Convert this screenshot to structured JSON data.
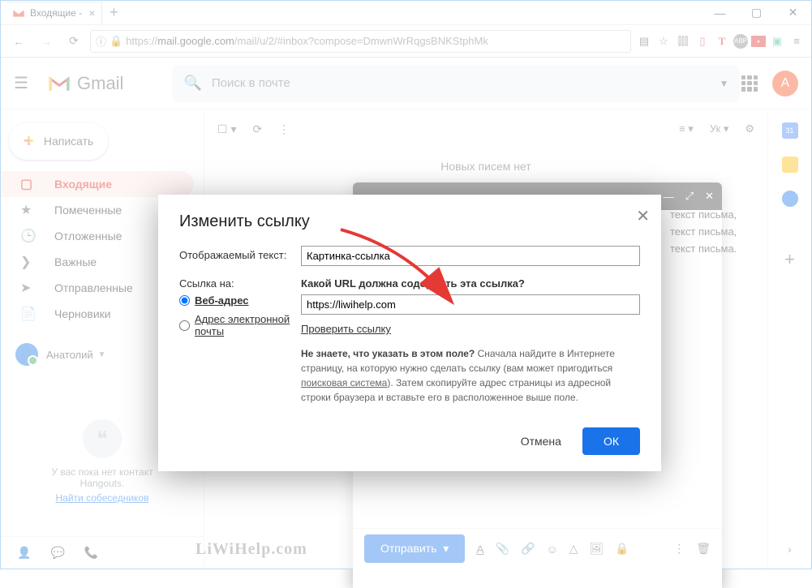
{
  "browser": {
    "tab_title": "Входящие -",
    "url_prefix": "https://",
    "url_host": "mail.google.com",
    "url_path": "/mail/u/2/#inbox?compose=DmwnWrRqgsBNKStphMk",
    "info_icon": "ⓘ"
  },
  "gmail": {
    "brand": "Gmail",
    "search_placeholder": "Поиск в почте",
    "avatar_letter": "А",
    "compose_label": "Написать",
    "nav": {
      "inbox": "Входящие",
      "starred": "Помеченные",
      "snoozed": "Отложенные",
      "important": "Важные",
      "sent": "Отправленные",
      "drafts": "Черновики"
    },
    "user_name": "Анатолий",
    "hangouts_empty1": "У вас пока нет контакт",
    "hangouts_empty2": "Hangouts.",
    "hangouts_link": "Найти собеседников",
    "no_mail": "Новых писем нет",
    "lang": "Ук",
    "split_icon": "≡",
    "watermark": "LiWiHelp.com",
    "rail_cal": "31"
  },
  "compose": {
    "body_text1": "текст письма,",
    "body_text2": "текст письма,",
    "body_text3": "текст письма.",
    "send": "Отправить"
  },
  "dialog": {
    "title": "Изменить ссылку",
    "text_label": "Отображаемый текст:",
    "text_value": "Картинка-ссылка",
    "link_to_label": "Ссылка на:",
    "radio_web": "Веб-адрес",
    "radio_email": "Адрес электронной почты",
    "url_prompt": "Какой URL должна содержать эта ссылка?",
    "url_value": "https://liwihelp.com",
    "test_link": "Проверить ссылку",
    "help_bold": "Не знаете, что указать в этом поле?",
    "help_text1": " Сначала найдите в Интернете страницу, на которую нужно сделать ссылку (вам может пригодиться ",
    "help_search": "поисковая система",
    "help_text2": "). Затем скопируйте адрес страницы из адресной строки браузера и вставьте его в расположенное выше поле.",
    "cancel": "Отмена",
    "ok": "ОК"
  }
}
